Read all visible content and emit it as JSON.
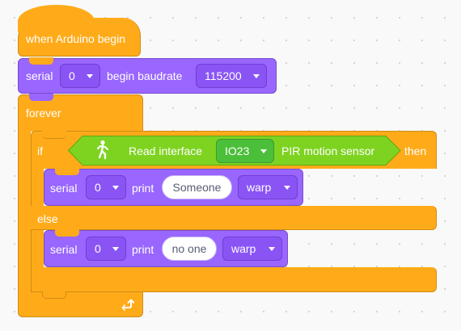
{
  "blocks": {
    "hat_label": "when Arduino begin",
    "serial_setup": {
      "label": "serial",
      "port": "0",
      "action": "begin baudrate",
      "baudrate": "115200"
    },
    "forever_label": "forever",
    "if_label": "if",
    "condition": {
      "label": "Read interface",
      "pin": "IO23",
      "sensor": "PIR motion sensor",
      "icon": "walking-person-icon"
    },
    "then_label": "then",
    "print_then": {
      "label": "serial",
      "port": "0",
      "action": "print",
      "text": "Someone",
      "mode": "warp"
    },
    "else_label": "else",
    "print_else": {
      "label": "serial",
      "port": "0",
      "action": "print",
      "text": "no one",
      "mode": "warp"
    },
    "loop_icon": "loop-arrow-icon"
  },
  "colors": {
    "events": "#ffab19",
    "serial": "#9966ff",
    "sensor": "#59c059",
    "workspace": "#f9f9f9"
  }
}
